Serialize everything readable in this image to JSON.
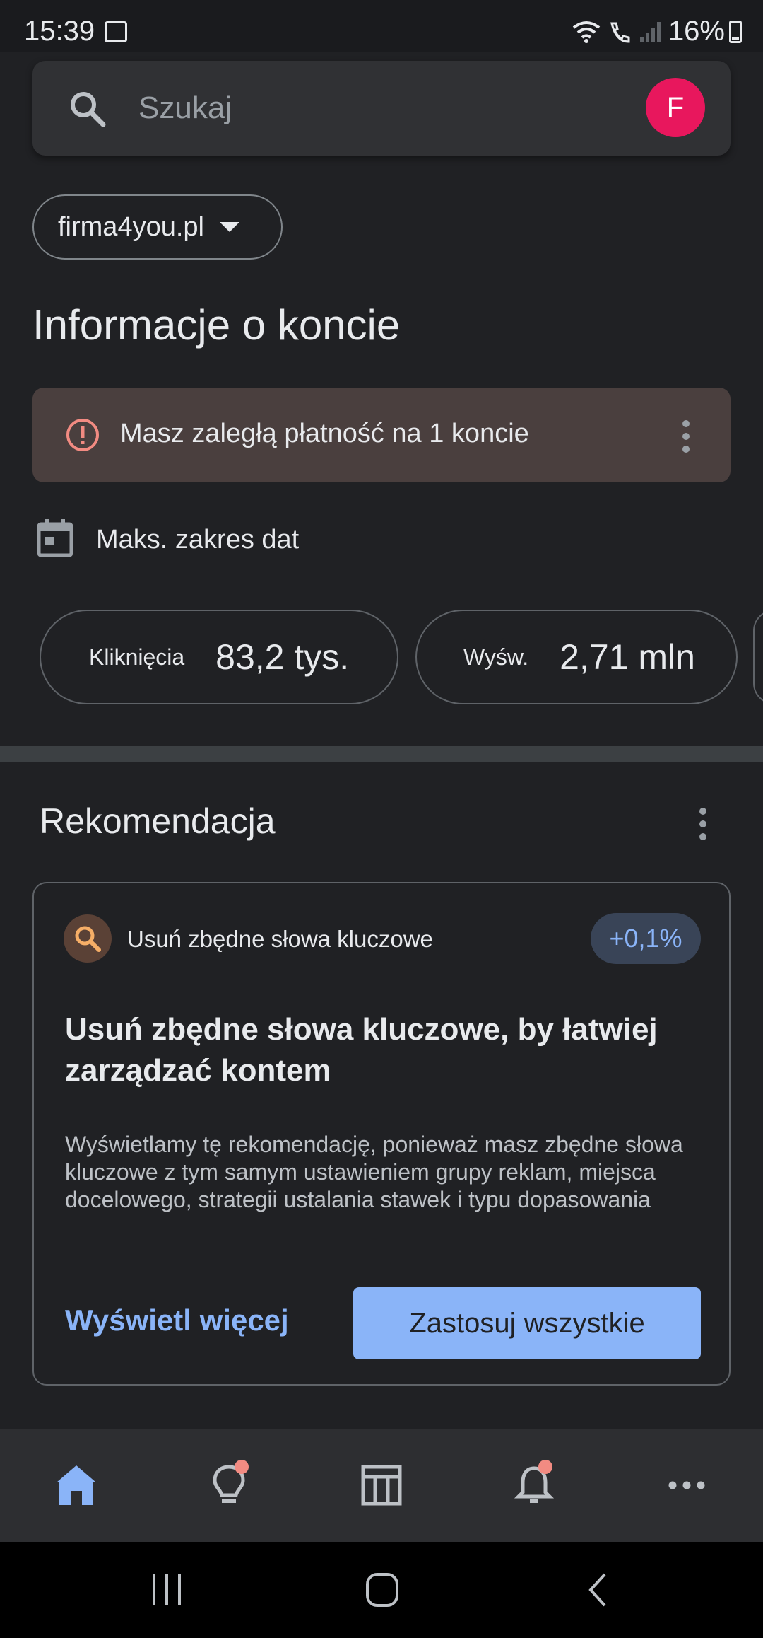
{
  "status_bar": {
    "time": "15:39",
    "battery": "16%"
  },
  "search": {
    "placeholder": "Szukaj",
    "avatar_letter": "F"
  },
  "account": {
    "name": "firma4you.pl"
  },
  "page_title": "Informacje o koncie",
  "alert": {
    "text": "Masz zaległą płatność na 1 koncie"
  },
  "date_range": {
    "label": "Maks. zakres dat"
  },
  "metrics": [
    {
      "label": "Kliknięcia",
      "value": "83,2 tys."
    },
    {
      "label": "Wyśw.",
      "value": "2,71 mln"
    }
  ],
  "recommendation": {
    "section_title": "Rekomendacja",
    "subtitle": "Usuń zbędne słowa kluczowe",
    "uplift": "+0,1%",
    "heading": "Usuń zbędne słowa kluczowe, by łatwiej zarządzać kontem",
    "body": "Wyświetlamy tę rekomendację, ponieważ masz zbędne słowa kluczowe z tym samym ustawieniem grupy reklam, miejsca docelowego, strategii ustalania stawek i typu dopasowania",
    "view_more": "Wyświetl więcej",
    "apply_all": "Zastosuj wszystkie"
  },
  "bottom_nav": [
    "home-icon",
    "lightbulb-icon",
    "table-icon",
    "bell-icon",
    "more-icon"
  ],
  "colors": {
    "accent": "#8ab4f8",
    "alert_bg": "#4a3f3e",
    "alert_icon": "#f28b82",
    "avatar": "#e8175d",
    "background": "#202124"
  }
}
